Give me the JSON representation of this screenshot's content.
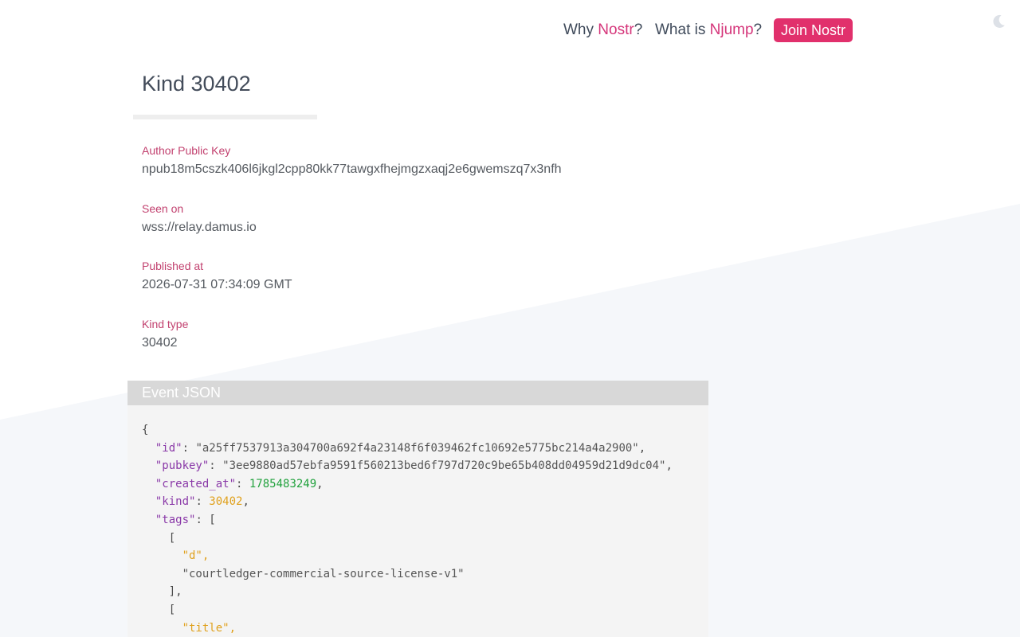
{
  "nav": {
    "why_prefix": "Why ",
    "why_accent": "Nostr",
    "why_suffix": "?",
    "what_prefix": "What is ",
    "what_accent": "Njump",
    "what_suffix": "?",
    "join_label": "Join Nostr",
    "theme_icon": "moon-icon"
  },
  "page": {
    "title": "Kind 30402"
  },
  "fields": {
    "author": {
      "label": "Author Public Key",
      "value": "npub18m5cszk406l6jkgl2cpp80kk77tawgxfhejmgzxaqj2e6gwemszq7x3nfh"
    },
    "seen": {
      "label": "Seen on",
      "value": "wss://relay.damus.io"
    },
    "published": {
      "label": "Published at",
      "value": "2026-07-31 07:34:09 GMT"
    },
    "kind": {
      "label": "Kind type",
      "value": "30402"
    }
  },
  "event_json": {
    "header": "Event JSON",
    "id_key": "\"id\"",
    "id": "\"a25ff7537913a304700a692f4a23148f6f039462fc10692e5775bc214a4a2900\"",
    "pubkey_key": "\"pubkey\"",
    "pubkey": "\"3ee9880ad57ebfa9591f560213bed6f797d720c9be65b408dd04959d21d9dc04\"",
    "created_at_key": "\"created_at\"",
    "created_at": "1785483249",
    "kind_key": "\"kind\"",
    "kind": "30402",
    "tags_key": "\"tags\"",
    "tag1_name": "\"d\"",
    "tag1_value": "\"courtledger-commercial-source-license-v1\"",
    "tag2_name": "\"title\""
  },
  "colors": {
    "accent": "#e1306c",
    "label": "#c2416f",
    "json_key": "#8a39a8",
    "json_number": "#22a23e",
    "json_highlight": "#e0a11d"
  }
}
